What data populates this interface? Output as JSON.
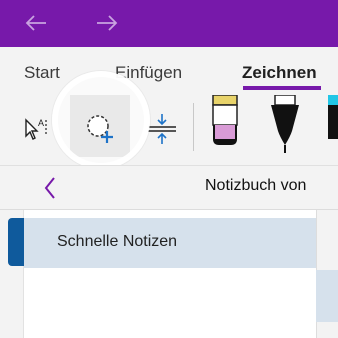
{
  "titlebar": {
    "back_icon": "arrow-left-icon",
    "forward_icon": "arrow-right-icon",
    "background": "#7719aa"
  },
  "ribbon": {
    "tabs": [
      {
        "label": "Start"
      },
      {
        "label": "Einfügen"
      },
      {
        "label": "Zeichnen",
        "active": true
      }
    ],
    "accent": "#7719aa"
  },
  "toolbar": {
    "tools": [
      {
        "icon": "lasso-select-icon"
      },
      {
        "icon": "add-space-select-icon",
        "active": true
      },
      {
        "icon": "insert-space-icon"
      },
      {
        "icon": "highlighter-pen-icon"
      },
      {
        "icon": "black-pen-icon"
      },
      {
        "icon": "cyan-pen-icon"
      }
    ]
  },
  "notebook": {
    "title": "Notizbuch von",
    "back_icon": "chevron-left-icon",
    "sections": [
      {
        "label": "Schnelle Notizen",
        "color": "#0f5a9c"
      }
    ]
  }
}
